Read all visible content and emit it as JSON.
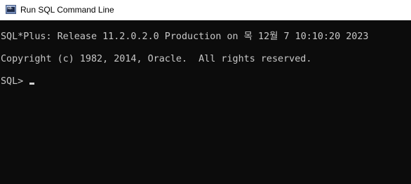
{
  "window": {
    "title": "Run SQL Command Line",
    "icon": "sqlplus-app-icon",
    "icon_text": "SQL"
  },
  "console": {
    "lines": [
      "SQL*Plus: Release 11.2.0.2.0 Production on 목 12월 7 10:10:20 2023",
      "Copyright (c) 1982, 2014, Oracle.  All rights reserved."
    ],
    "prompt": "SQL> ",
    "input_value": ""
  },
  "colors": {
    "console_background": "#0c0c0c",
    "console_text": "#c8c8c8",
    "titlebar_background": "#ffffff"
  }
}
